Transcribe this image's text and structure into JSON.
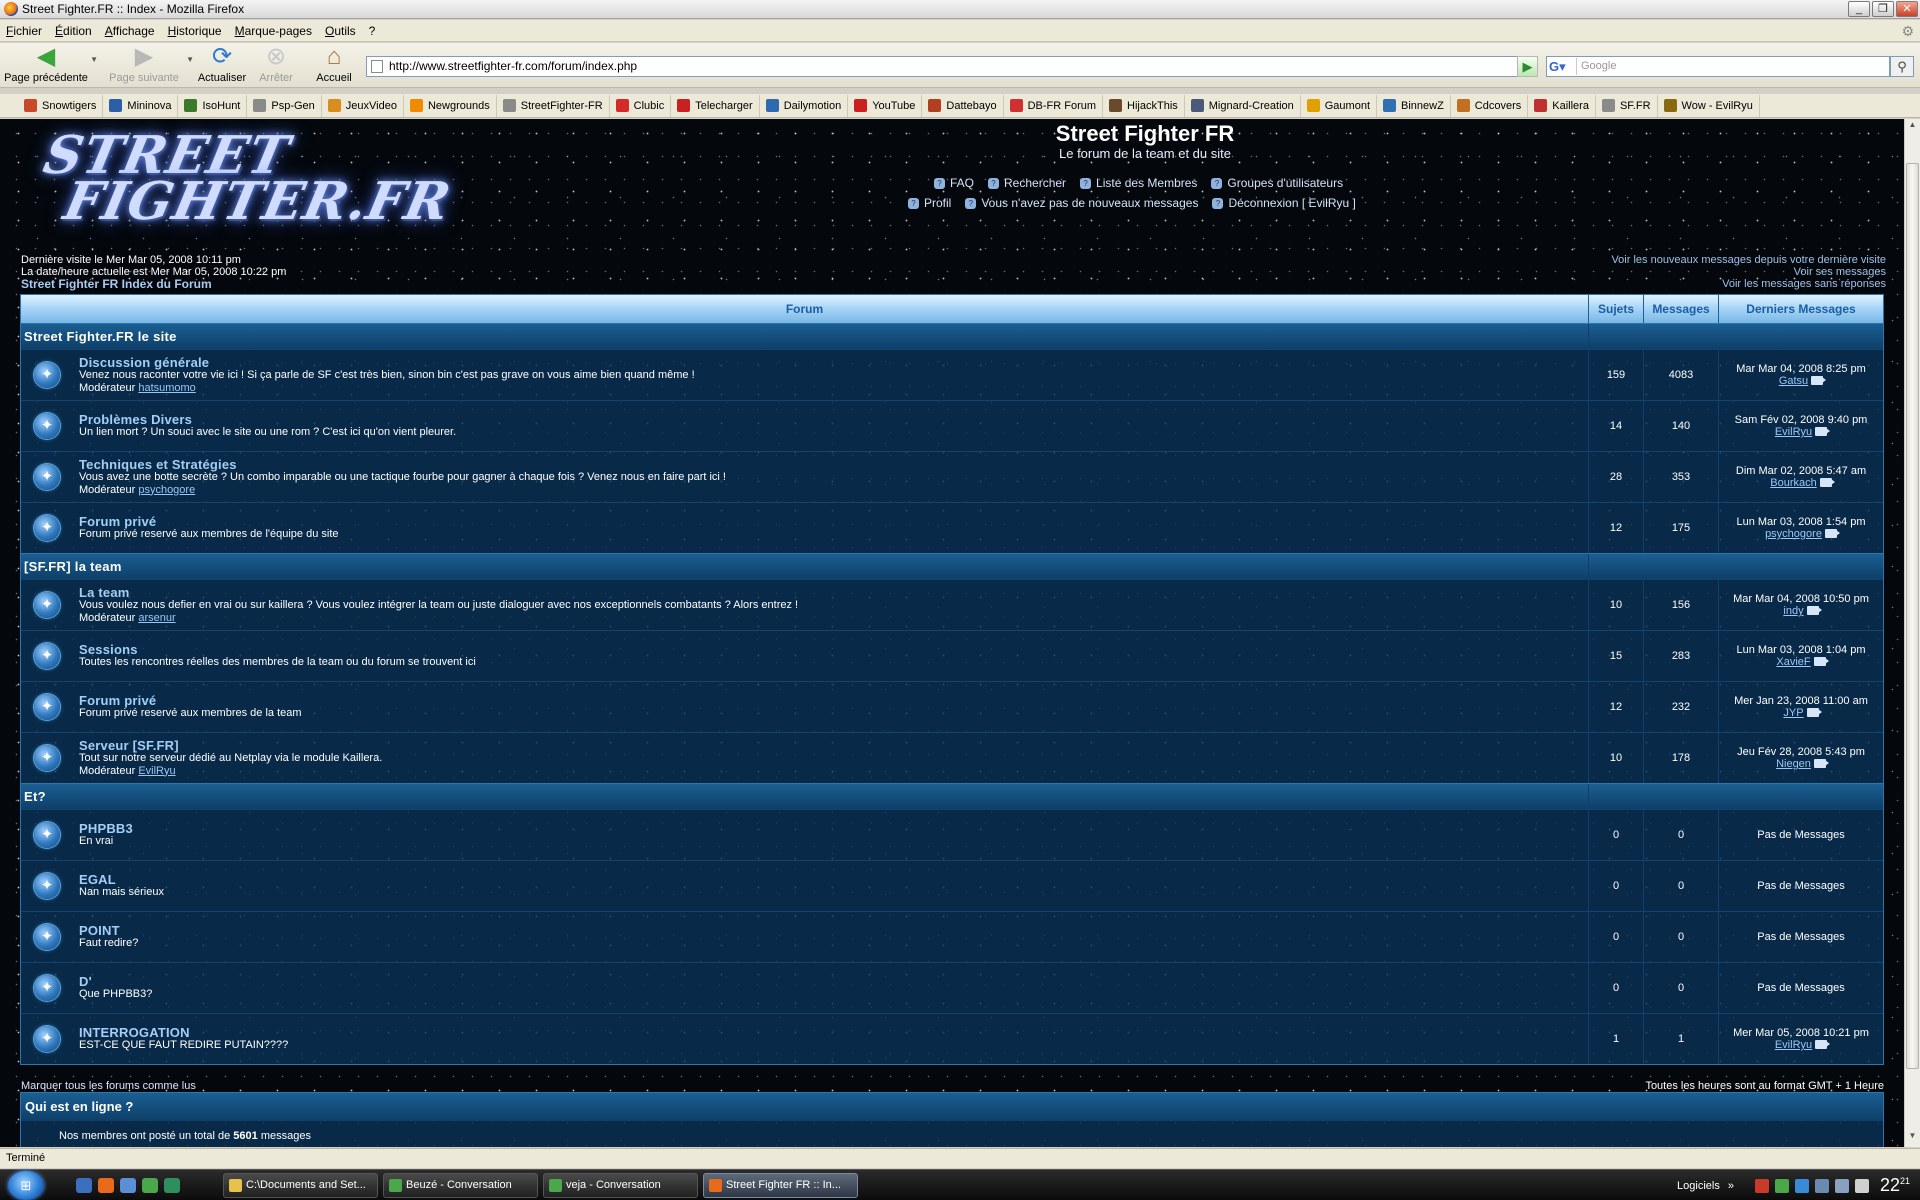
{
  "window": {
    "title": "Street Fighter.FR :: Index - Mozilla Firefox"
  },
  "menu": [
    "Fichier",
    "Édition",
    "Affichage",
    "Historique",
    "Marque-pages",
    "Outils",
    "?"
  ],
  "toolbar": {
    "back": "Page précédente",
    "forward": "Page suivante",
    "reload": "Actualiser",
    "stop": "Arrêter",
    "home": "Accueil",
    "url": "http://www.streetfighter-fr.com/forum/index.php",
    "search_placeholder": "Google"
  },
  "bookmarks": [
    {
      "label": "Snowtigers",
      "color": "#c8482a"
    },
    {
      "label": "Mininova",
      "color": "#2d5fa8"
    },
    {
      "label": "IsoHunt",
      "color": "#3a7a2a"
    },
    {
      "label": "Psp-Gen",
      "color": "#8a8a8a"
    },
    {
      "label": "JeuxVideo",
      "color": "#d98d1c"
    },
    {
      "label": "Newgrounds",
      "color": "#f08a00"
    },
    {
      "label": "StreetFighter-FR",
      "color": "#8a8a8a"
    },
    {
      "label": "Clubic",
      "color": "#d62a2a"
    },
    {
      "label": "Telecharger",
      "color": "#c92020"
    },
    {
      "label": "Dailymotion",
      "color": "#2e6ab0"
    },
    {
      "label": "YouTube",
      "color": "#cc1f1f"
    },
    {
      "label": "Dattebayo",
      "color": "#b04020"
    },
    {
      "label": "DB-FR Forum",
      "color": "#d03030"
    },
    {
      "label": "HijackThis",
      "color": "#6a4a2a"
    },
    {
      "label": "Mignard-Creation",
      "color": "#4a5a7a"
    },
    {
      "label": "Gaumont",
      "color": "#e0a000"
    },
    {
      "label": "BinnewZ",
      "color": "#3070b0"
    },
    {
      "label": "Cdcovers",
      "color": "#c07020"
    },
    {
      "label": "Kaillera",
      "color": "#c03030"
    },
    {
      "label": "SF.FR",
      "color": "#8a8a8a"
    },
    {
      "label": "Wow - EvilRyu",
      "color": "#8a6a10"
    }
  ],
  "header": {
    "logo": "STREET FIGHTER.FR",
    "site_title": "Street Fighter FR",
    "site_subtitle": "Le forum de la team et du site",
    "nav_row1": [
      "FAQ",
      "Rechercher",
      "Liste des Membres",
      "Groupes d'utilisateurs"
    ],
    "nav_row2": [
      "Profil",
      "Vous n'avez pas de nouveaux messages",
      "Déconnexion [ EvilRyu ]"
    ]
  },
  "info": {
    "last_visit": "Dernière visite le Mer Mar 05, 2008 10:11 pm",
    "current_date": "La date/heure actuelle est Mer Mar 05, 2008 10:22 pm",
    "index_link": "Street Fighter FR Index du Forum",
    "new_since": "Voir les nouveaux messages depuis votre dernière visite",
    "your_posts": "Voir ses messages",
    "unanswered": "Voir les messages sans réponses"
  },
  "table": {
    "headers": [
      "Forum",
      "Sujets",
      "Messages",
      "Derniers Messages"
    ],
    "moderator_label": "Modérateur",
    "categories": [
      {
        "name": "Street Fighter.FR le site",
        "forums": [
          {
            "name": "Discussion générale",
            "desc": "Venez nous raconter votre vie ici ! Si ça parle de SF c'est très bien, sinon bin c'est pas grave on vous aime bien quand même !",
            "mod": "hatsumomo",
            "topics": "159",
            "posts": "4083",
            "last_date": "Mar Mar 04, 2008 8:25 pm",
            "last_user": "Gatsu"
          },
          {
            "name": "Problèmes Divers",
            "desc": "Un lien mort ? Un souci avec le site ou une rom ? C'est ici qu'on vient pleurer.",
            "mod": "",
            "topics": "14",
            "posts": "140",
            "last_date": "Sam Fév 02, 2008 9:40 pm",
            "last_user": "EvilRyu"
          },
          {
            "name": "Techniques et Stratégies",
            "desc": "Vous avez une botte secrète ? Un combo imparable ou une tactique fourbe pour gagner à chaque fois ? Venez nous en faire part ici !",
            "mod": "psychogore",
            "topics": "28",
            "posts": "353",
            "last_date": "Dim Mar 02, 2008 5:47 am",
            "last_user": "Bourkach"
          },
          {
            "name": "Forum privé",
            "desc": "Forum privé reservé aux membres de l'équipe du site",
            "mod": "",
            "topics": "12",
            "posts": "175",
            "last_date": "Lun Mar 03, 2008 1:54 pm",
            "last_user": "psychogore"
          }
        ]
      },
      {
        "name": "[SF.FR] la team",
        "forums": [
          {
            "name": "La team",
            "desc": "Vous voulez nous defier en vrai ou sur kaillera ? Vous voulez intégrer la team ou juste dialoguer avec nos exceptionnels combatants ? Alors entrez !",
            "mod": "arsenur",
            "topics": "10",
            "posts": "156",
            "last_date": "Mar Mar 04, 2008 10:50 pm",
            "last_user": "indy"
          },
          {
            "name": "Sessions",
            "desc": "Toutes les rencontres réelles des membres de la team ou du forum se trouvent ici",
            "mod": "",
            "topics": "15",
            "posts": "283",
            "last_date": "Lun Mar 03, 2008 1:04 pm",
            "last_user": "XavieF"
          },
          {
            "name": "Forum privé",
            "desc": "Forum privé reservé aux membres de la team",
            "mod": "",
            "topics": "12",
            "posts": "232",
            "last_date": "Mer Jan 23, 2008 11:00 am",
            "last_user": "JYP"
          },
          {
            "name": "Serveur [SF.FR]",
            "desc": "Tout sur notre serveur dédié au Netplay via le module Kaillera.",
            "mod": "EvilRyu",
            "topics": "10",
            "posts": "178",
            "last_date": "Jeu Fév 28, 2008 5:43 pm",
            "last_user": "Niegen"
          }
        ]
      },
      {
        "name": "Et?",
        "forums": [
          {
            "name": "PHPBB3",
            "desc": "En vrai",
            "mod": "",
            "topics": "0",
            "posts": "0",
            "last_date": "Pas de Messages",
            "last_user": ""
          },
          {
            "name": "EGAL",
            "desc": "Nan mais sérieux",
            "mod": "",
            "topics": "0",
            "posts": "0",
            "last_date": "Pas de Messages",
            "last_user": ""
          },
          {
            "name": "POINT",
            "desc": "Faut redire?",
            "mod": "",
            "topics": "0",
            "posts": "0",
            "last_date": "Pas de Messages",
            "last_user": ""
          },
          {
            "name": "D'",
            "desc": "Que PHPBB3?",
            "mod": "",
            "topics": "0",
            "posts": "0",
            "last_date": "Pas de Messages",
            "last_user": ""
          },
          {
            "name": "INTERROGATION",
            "desc": "EST-CE QUE FAUT REDIRE PUTAIN????",
            "mod": "",
            "topics": "1",
            "posts": "1",
            "last_date": "Mer Mar 05, 2008 10:21 pm",
            "last_user": "EvilRyu"
          }
        ]
      }
    ]
  },
  "footer": {
    "mark_read": "Marquer tous les forums comme lus",
    "timezone": "Toutes les heures sont au format GMT + 1 Heure",
    "online_title": "Qui est en ligne ?",
    "online_text_prefix": "Nos membres ont posté un total de",
    "online_total": "5601",
    "online_text_suffix": "messages"
  },
  "status": "Terminé",
  "taskbar": {
    "tasks": [
      "C:\\Documents and Set...",
      "Beuzé - Conversation",
      "veja - Conversation",
      "Street Fighter FR :: In..."
    ],
    "tray_label": "Logiciels",
    "clock": "22",
    "clock_min": "21"
  },
  "colors": {
    "accent": "#2d76ad",
    "header_gradient_top": "#e1f2ff",
    "link": "#a4cef6"
  }
}
